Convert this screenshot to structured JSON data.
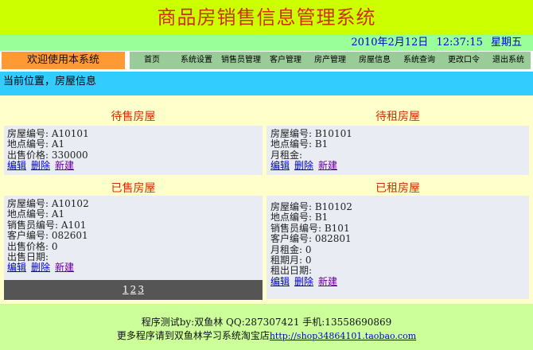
{
  "header": {
    "title": "商品房销售信息管理系统"
  },
  "datebar": {
    "date": "2010年2月12日",
    "time": "12:37:15",
    "weekday": "星期五"
  },
  "welcome": "欢迎使用本系统",
  "menu": [
    "首页",
    "系统设置",
    "销售员管理",
    "客户管理",
    "房产管理",
    "房屋信息",
    "系统查询",
    "更改口令",
    "退出系统"
  ],
  "breadcrumb": "当前位置，房屋信息",
  "for_sale": {
    "heading": "待售房屋",
    "lines": [
      "房屋编号: A10101",
      "地点编号: A1",
      "出售价格: 330000"
    ]
  },
  "for_rent": {
    "heading": "待租房屋",
    "lines": [
      "房屋编号: B10101",
      "地点编号: B1",
      "月租金:"
    ]
  },
  "sold": {
    "heading": "已售房屋",
    "lines": [
      "房屋编号: A10102",
      "地点编号: A1",
      "销售员编号: A101",
      "客户编号: 082601",
      "出售价格: 0",
      "出售日期:"
    ]
  },
  "rented": {
    "heading": "已租房屋",
    "lines": [
      "房屋编号: B10102",
      "地点编号: B1",
      "销售员编号: B101",
      "客户编号: 082801",
      "月租金: 0",
      "租期月: 0",
      "租出日期:"
    ]
  },
  "actions": {
    "edit": "编辑",
    "delete": "删除",
    "new": "新建"
  },
  "pager": [
    "1",
    "2",
    "3"
  ],
  "footer": {
    "line1": "程序测试by:双鱼林 QQ:287307421 手机:13558690869",
    "line2_prefix": "更多程序请到双鱼林学习系统淘宝店",
    "line2_url": "http://shop34864101.taobao.com"
  }
}
